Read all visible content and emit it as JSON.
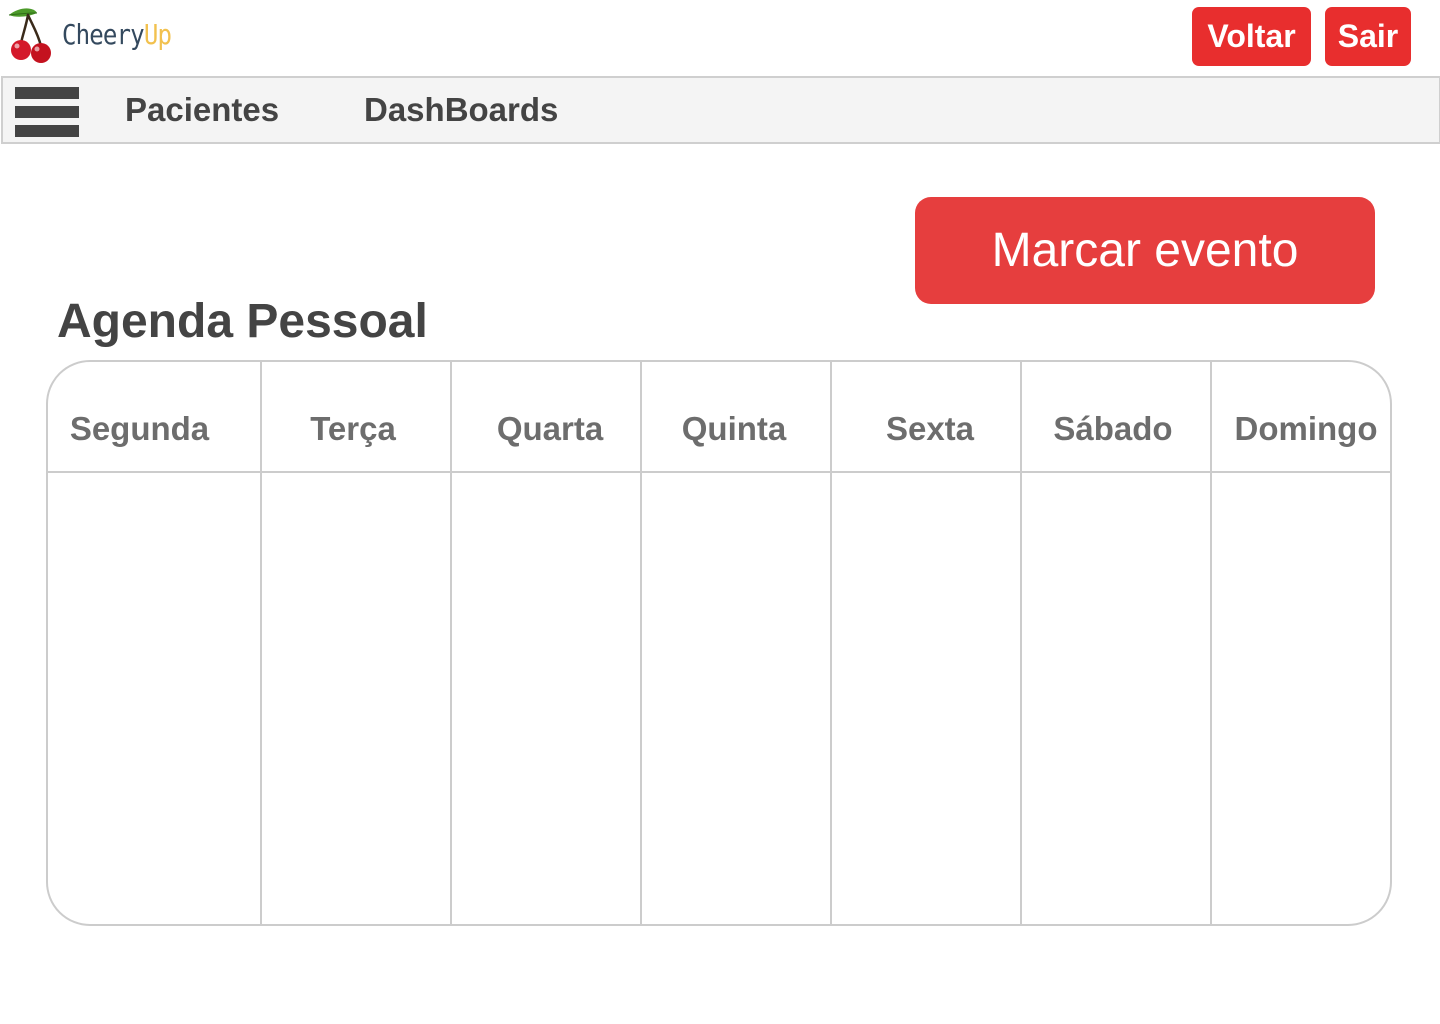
{
  "header": {
    "logo": {
      "word1": "Cheery",
      "word2": "Up",
      "icon": "cherry-icon"
    },
    "voltar_label": "Voltar",
    "sair_label": "Sair"
  },
  "nav": {
    "menu_icon": "hamburger-menu-icon",
    "items": [
      {
        "label": "Pacientes"
      },
      {
        "label": "DashBoards"
      }
    ]
  },
  "main": {
    "marcar_evento_label": "Marcar evento",
    "title": "Agenda Pessoal"
  },
  "calendar": {
    "days": [
      {
        "label": "Segunda"
      },
      {
        "label": "Terça"
      },
      {
        "label": "Quarta"
      },
      {
        "label": "Quinta"
      },
      {
        "label": "Sexta"
      },
      {
        "label": "Sábado"
      },
      {
        "label": "Domingo"
      }
    ]
  },
  "colors": {
    "accent_red": "#e82e2e",
    "button_red": "#e63e3e",
    "logo_dark": "#34495e",
    "logo_yellow": "#f2c14e",
    "text_dark": "#444444",
    "text_muted": "#6d6d6d",
    "border": "#cccccc",
    "nav_background": "#f4f4f4"
  }
}
